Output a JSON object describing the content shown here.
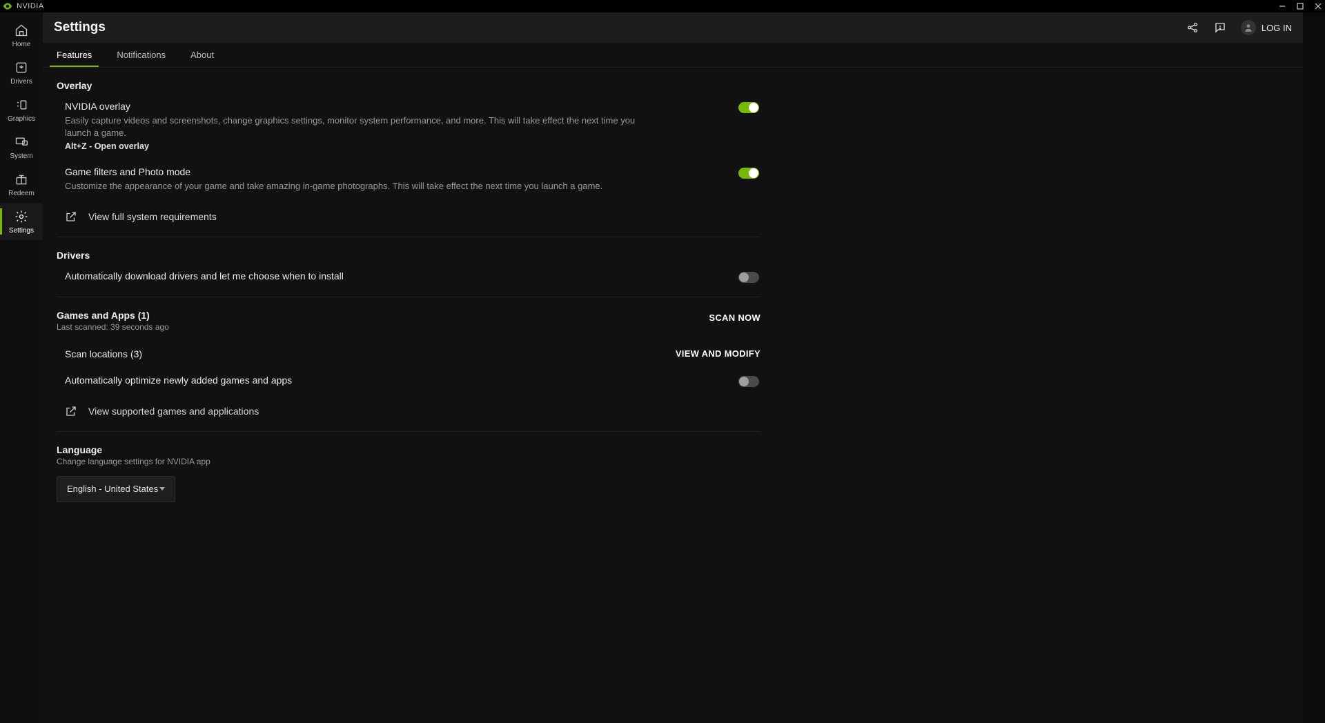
{
  "titlebar": {
    "brand": "NVIDIA"
  },
  "sidebar": {
    "items": [
      {
        "label": "Home"
      },
      {
        "label": "Drivers"
      },
      {
        "label": "Graphics"
      },
      {
        "label": "System"
      },
      {
        "label": "Redeem"
      },
      {
        "label": "Settings"
      }
    ]
  },
  "header": {
    "title": "Settings",
    "login": "LOG IN"
  },
  "tabs": [
    {
      "label": "Features"
    },
    {
      "label": "Notifications"
    },
    {
      "label": "About"
    }
  ],
  "overlay": {
    "section": "Overlay",
    "nvidia_overlay": {
      "title": "NVIDIA overlay",
      "desc": "Easily capture videos and screenshots, change graphics settings, monitor system performance, and more. This will take effect the next time you launch a game.",
      "hint": "Alt+Z - Open overlay"
    },
    "game_filters": {
      "title": "Game filters and Photo mode",
      "desc": "Customize the appearance of your game and take amazing in-game photographs. This will take effect the next time you launch a game."
    },
    "sysreq_link": "View full system requirements"
  },
  "drivers": {
    "section": "Drivers",
    "auto_download": "Automatically download drivers and let me choose when to install"
  },
  "games": {
    "section": "Games and Apps (1)",
    "last_scanned": "Last scanned: 39 seconds ago",
    "scan_now": "SCAN NOW",
    "scan_locations": "Scan locations (3)",
    "view_modify": "VIEW AND MODIFY",
    "auto_optimize": "Automatically optimize newly added games and apps",
    "supported_link": "View supported games and applications"
  },
  "language": {
    "section": "Language",
    "desc": "Change language settings for NVIDIA app",
    "selected": "English - United States"
  },
  "colors": {
    "accent": "#76b900"
  }
}
